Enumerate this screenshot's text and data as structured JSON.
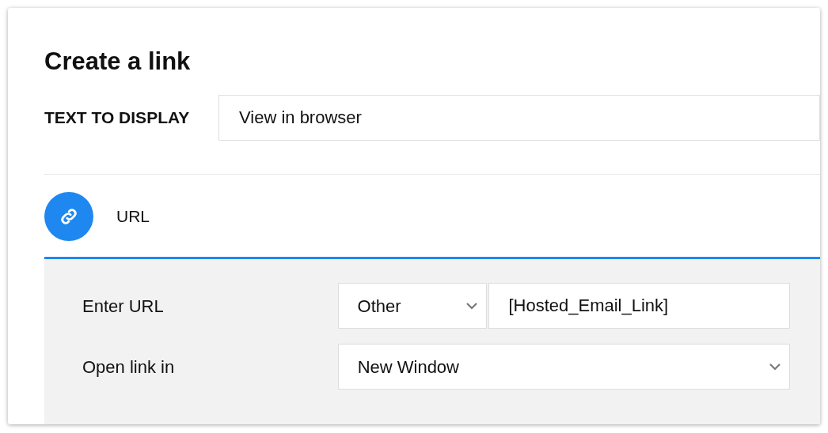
{
  "dialog": {
    "title": "Create a link"
  },
  "text_to_display": {
    "label": "TEXT TO DISPLAY",
    "value": "View in browser"
  },
  "link_types": [
    {
      "label": "URL",
      "selected": true
    }
  ],
  "url_form": {
    "rows": [
      {
        "label": "Enter URL",
        "kind": "select_input",
        "select": "Other",
        "value": "[Hosted_Email_Link]"
      },
      {
        "label": "Open link in",
        "kind": "select",
        "select": "New Window"
      }
    ]
  }
}
